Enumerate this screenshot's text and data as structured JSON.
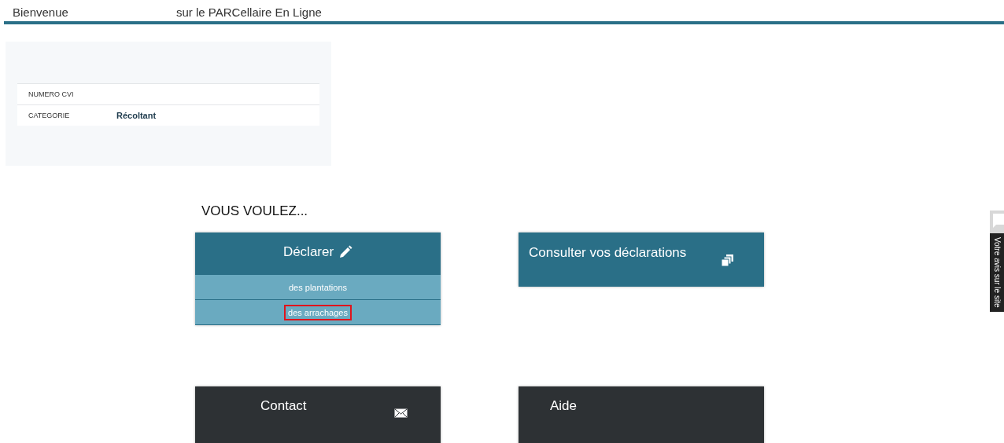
{
  "header": {
    "greeting": "Bienvenue",
    "title": "sur le PARCellaire En Ligne"
  },
  "info_table": {
    "rows": [
      {
        "label": "NUMERO CVI",
        "value": ""
      },
      {
        "label": "CATEGORIE",
        "value": "Récoltant"
      }
    ]
  },
  "prompt": "VOUS VOULEZ...",
  "cards": [
    {
      "kind": "declare",
      "title": "Déclarer",
      "options": [
        {
          "label": "des plantations",
          "highlighted": false
        },
        {
          "label": "des arrachages",
          "highlighted": true
        }
      ]
    },
    {
      "kind": "consult",
      "title": "Consulter vos déclarations"
    },
    {
      "kind": "contact",
      "title": "Contact"
    },
    {
      "kind": "help",
      "title": "Aide"
    }
  ],
  "feedback_tab": {
    "label": "Votre avis sur le site"
  }
}
